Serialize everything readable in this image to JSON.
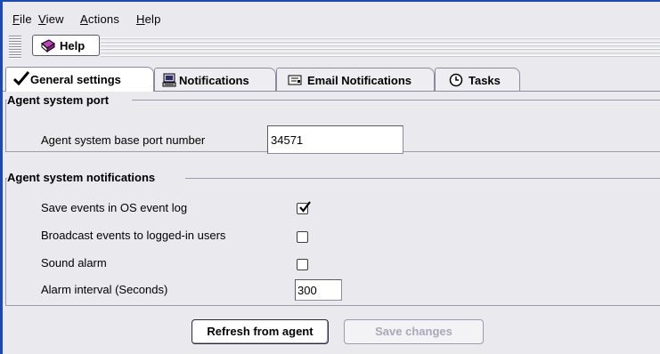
{
  "menu": {
    "items": [
      {
        "label": "File",
        "u": "F",
        "rest": "ile"
      },
      {
        "label": "View",
        "u": "V",
        "rest": "iew"
      },
      {
        "label": "Actions",
        "u": "A",
        "rest": "ctions"
      },
      {
        "label": "Help",
        "u": "H",
        "rest": "elp"
      }
    ]
  },
  "toolbar": {
    "help_label": "Help"
  },
  "tabs": [
    {
      "label": "General settings",
      "icon": "checkmark-icon",
      "active": true
    },
    {
      "label": "Notifications",
      "icon": "computer-icon",
      "active": false
    },
    {
      "label": "Email Notifications",
      "icon": "email-icon",
      "active": false
    },
    {
      "label": "Tasks",
      "icon": "clock-icon",
      "active": false
    }
  ],
  "port_group": {
    "title": "Agent system port",
    "base_port_label": "Agent system base port number",
    "base_port_value": "34571"
  },
  "notif_group": {
    "title": "Agent system notifications",
    "save_events_label": "Save events in OS event log",
    "save_events_checked": true,
    "broadcast_label": "Broadcast events to logged-in users",
    "broadcast_checked": false,
    "sound_alarm_label": "Sound alarm",
    "sound_alarm_checked": false,
    "interval_label": "Alarm interval (Seconds)",
    "interval_value": "300"
  },
  "buttons": {
    "refresh_label": "Refresh from agent",
    "save_label": "Save changes"
  },
  "colors": {
    "frame": "#1a48b8",
    "panel": "#eaeaee",
    "disabled_text": "#a8a8b8"
  }
}
